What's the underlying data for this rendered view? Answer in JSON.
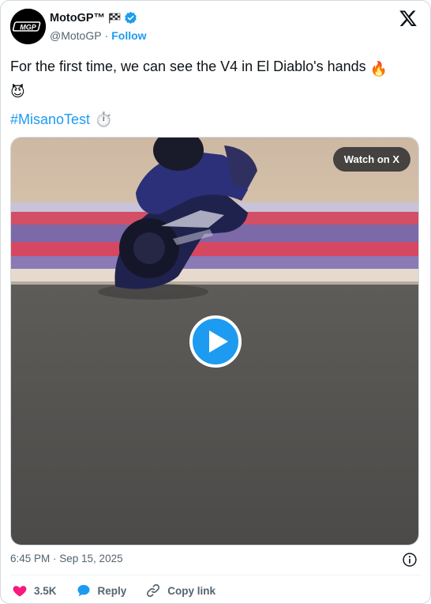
{
  "author": {
    "display_name": "MotoGP™",
    "avatar_text": "MGP",
    "handle": "@MotoGP",
    "separator": "·",
    "follow_label": "Follow"
  },
  "tweet": {
    "text": "For the first time, we can see the V4 in El Diablo's hands",
    "emoji_fire": "🔥",
    "emoji_devil": "😈",
    "hashtag": "#MisanoTest",
    "emoji_stopwatch": "⏱️"
  },
  "media": {
    "watch_label": "Watch on X"
  },
  "footer": {
    "timestamp": "6:45 PM · Sep 15, 2025"
  },
  "actions": {
    "like_count": "3.5K",
    "reply_label": "Reply",
    "copy_link_label": "Copy link"
  },
  "colors": {
    "accent": "#1d9bf0",
    "like": "#f91880",
    "text": "#0f1419",
    "secondary": "#536471"
  }
}
